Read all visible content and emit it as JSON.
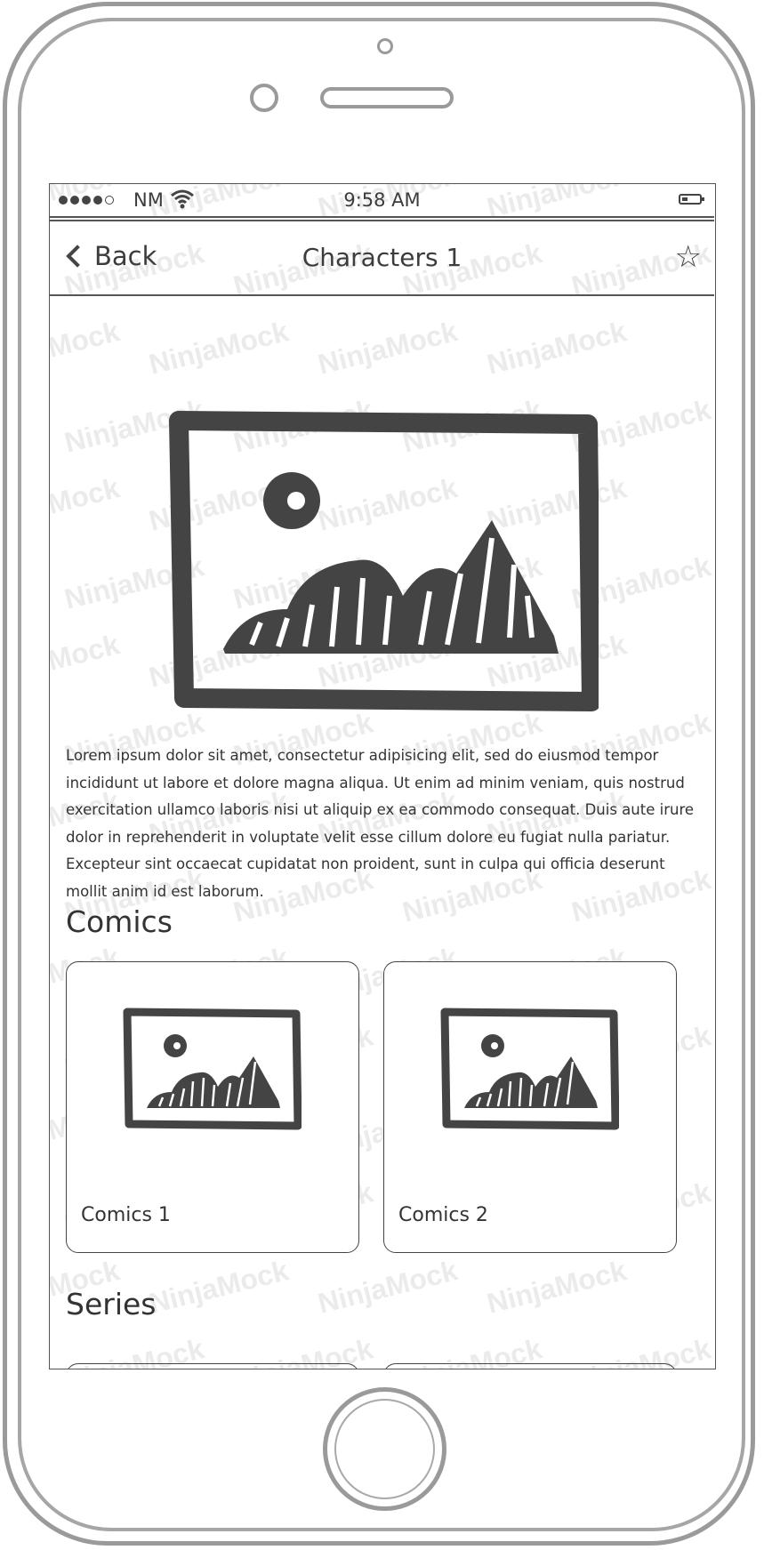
{
  "status_bar": {
    "carrier": "NM",
    "time": "9:58 AM"
  },
  "nav": {
    "back_label": "Back",
    "title": "Characters 1",
    "favorite_icon": "star-icon"
  },
  "hero": {
    "image_icon": "image-placeholder-icon"
  },
  "description": "Lorem ipsum dolor sit amet, consectetur adipisicing elit, sed do eiusmod tempor incididunt ut labore et dolore magna aliqua. Ut enim ad minim veniam, quis nostrud exercitation ullamco laboris nisi ut aliquip ex ea commodo consequat. Duis aute irure dolor in reprehenderit in voluptate velit esse cillum dolore eu fugiat nulla pariatur. Excepteur sint occaecat cupidatat non proident, sunt in culpa qui officia deserunt mollit anim id est laborum.",
  "comics": {
    "heading": "Comics",
    "items": [
      {
        "label": "Comics 1"
      },
      {
        "label": "Comics 2"
      }
    ]
  },
  "series": {
    "heading": "Series"
  },
  "watermark": "NinjaMock",
  "colors": {
    "ink": "#3c3c3c",
    "frame": "#9a9a9a",
    "watermark": "#ebebeb"
  }
}
